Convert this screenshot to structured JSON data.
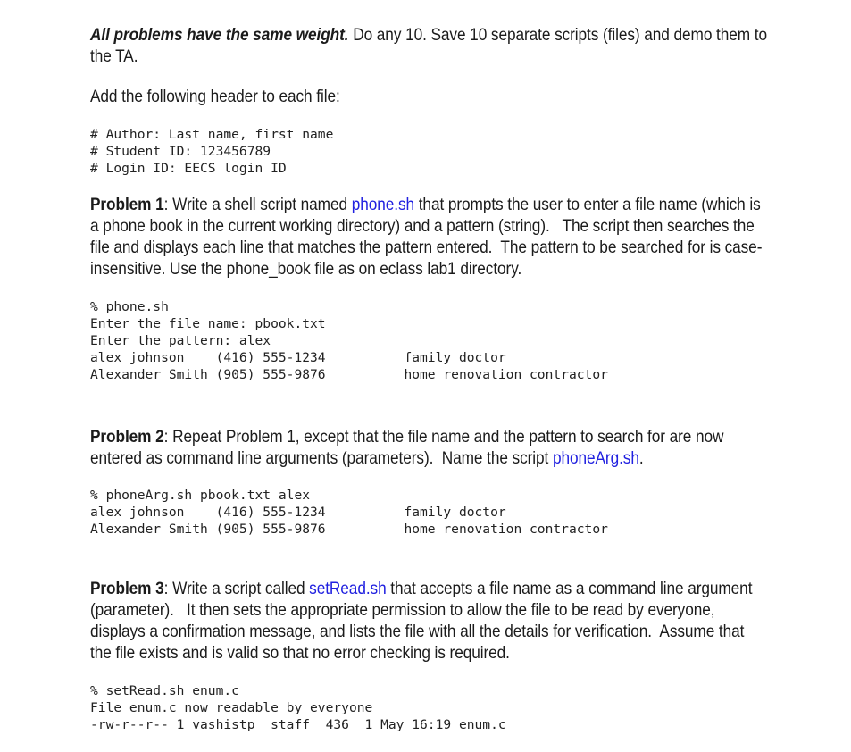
{
  "document": {
    "intro": {
      "emphasis": "All problems have the same weight.",
      "rest": " Do any 10. Save 10 separate scripts (files) and demo them to the TA."
    },
    "header_instruction": "Add the following header to each file:",
    "header_code": "# Author: Last name, first name\n# Student ID: 123456789\n# Login ID: EECS login ID",
    "problems": [
      {
        "label": "Problem 1",
        "colon": ": ",
        "text_before_link": "Write a shell script named ",
        "link": "phone.sh",
        "text_after_link": " that prompts the user to enter a file name (which is a phone book in the current working directory) and a pattern (string).   The script then searches the file and displays each line that matches the pattern entered.  The pattern to be searched for is case-insensitive. Use the phone_book file as on eclass lab1 directory.",
        "code": "% phone.sh\nEnter the file name: pbook.txt\nEnter the pattern: alex\nalex johnson    (416) 555-1234          family doctor\nAlexander Smith (905) 555-9876          home renovation contractor"
      },
      {
        "label": "Problem 2",
        "colon": ": ",
        "text_before_link": "Repeat Problem 1, except that the file name and the pattern to search for are now entered as command line arguments (parameters).  Name the script ",
        "link": "phoneArg.sh",
        "text_after_link": ".",
        "code": "% phoneArg.sh pbook.txt alex\nalex johnson    (416) 555-1234          family doctor\nAlexander Smith (905) 555-9876          home renovation contractor"
      },
      {
        "label": "Problem 3",
        "colon": ": ",
        "text_before_link": "Write a script called ",
        "link": "setRead.sh",
        "text_after_link": " that accepts a file name as a command line argument (parameter).   It then sets the appropriate permission to allow the file to be read by everyone, displays a confirmation message, and lists the file with all the details for verification.  Assume that the file exists and is valid so that no error checking is required.",
        "code": "% setRead.sh enum.c\nFile enum.c now readable by everyone\n-rw-r--r-- 1 vashistp  staff  436  1 May 16:19 enum.c"
      }
    ],
    "colors": {
      "link": "#2121e0",
      "text": "#1b1b1b",
      "code": "#222222",
      "background": "#ffffff"
    }
  }
}
